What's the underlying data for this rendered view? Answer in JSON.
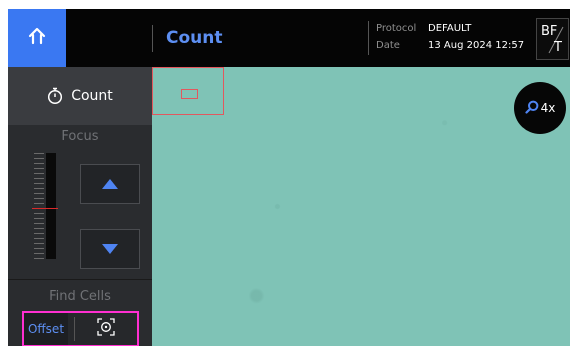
{
  "header": {
    "title": "Count",
    "protocol_label": "Protocol",
    "protocol_value": "DEFAULT",
    "date_label": "Date",
    "date_value": "13 Aug 2024 12:57",
    "mode_top": "BF",
    "mode_bottom": "T"
  },
  "sidebar": {
    "count_label": "Count",
    "focus_label": "Focus",
    "find_cells_label": "Find Cells",
    "offset_label": "Offset"
  },
  "viewer": {
    "zoom_label": "4x"
  },
  "colors": {
    "accent": "#3a78f2",
    "title": "#5d8ff2",
    "highlight": "#ff2fd1",
    "viewer_bg": "#7fc3b6",
    "marker": "#d92a2a"
  },
  "icons": {
    "home": "home-icon",
    "timer": "timer-icon",
    "up": "arrow-up-icon",
    "down": "arrow-down-icon",
    "target": "locate-target-icon",
    "zoom": "magnifier-icon"
  }
}
